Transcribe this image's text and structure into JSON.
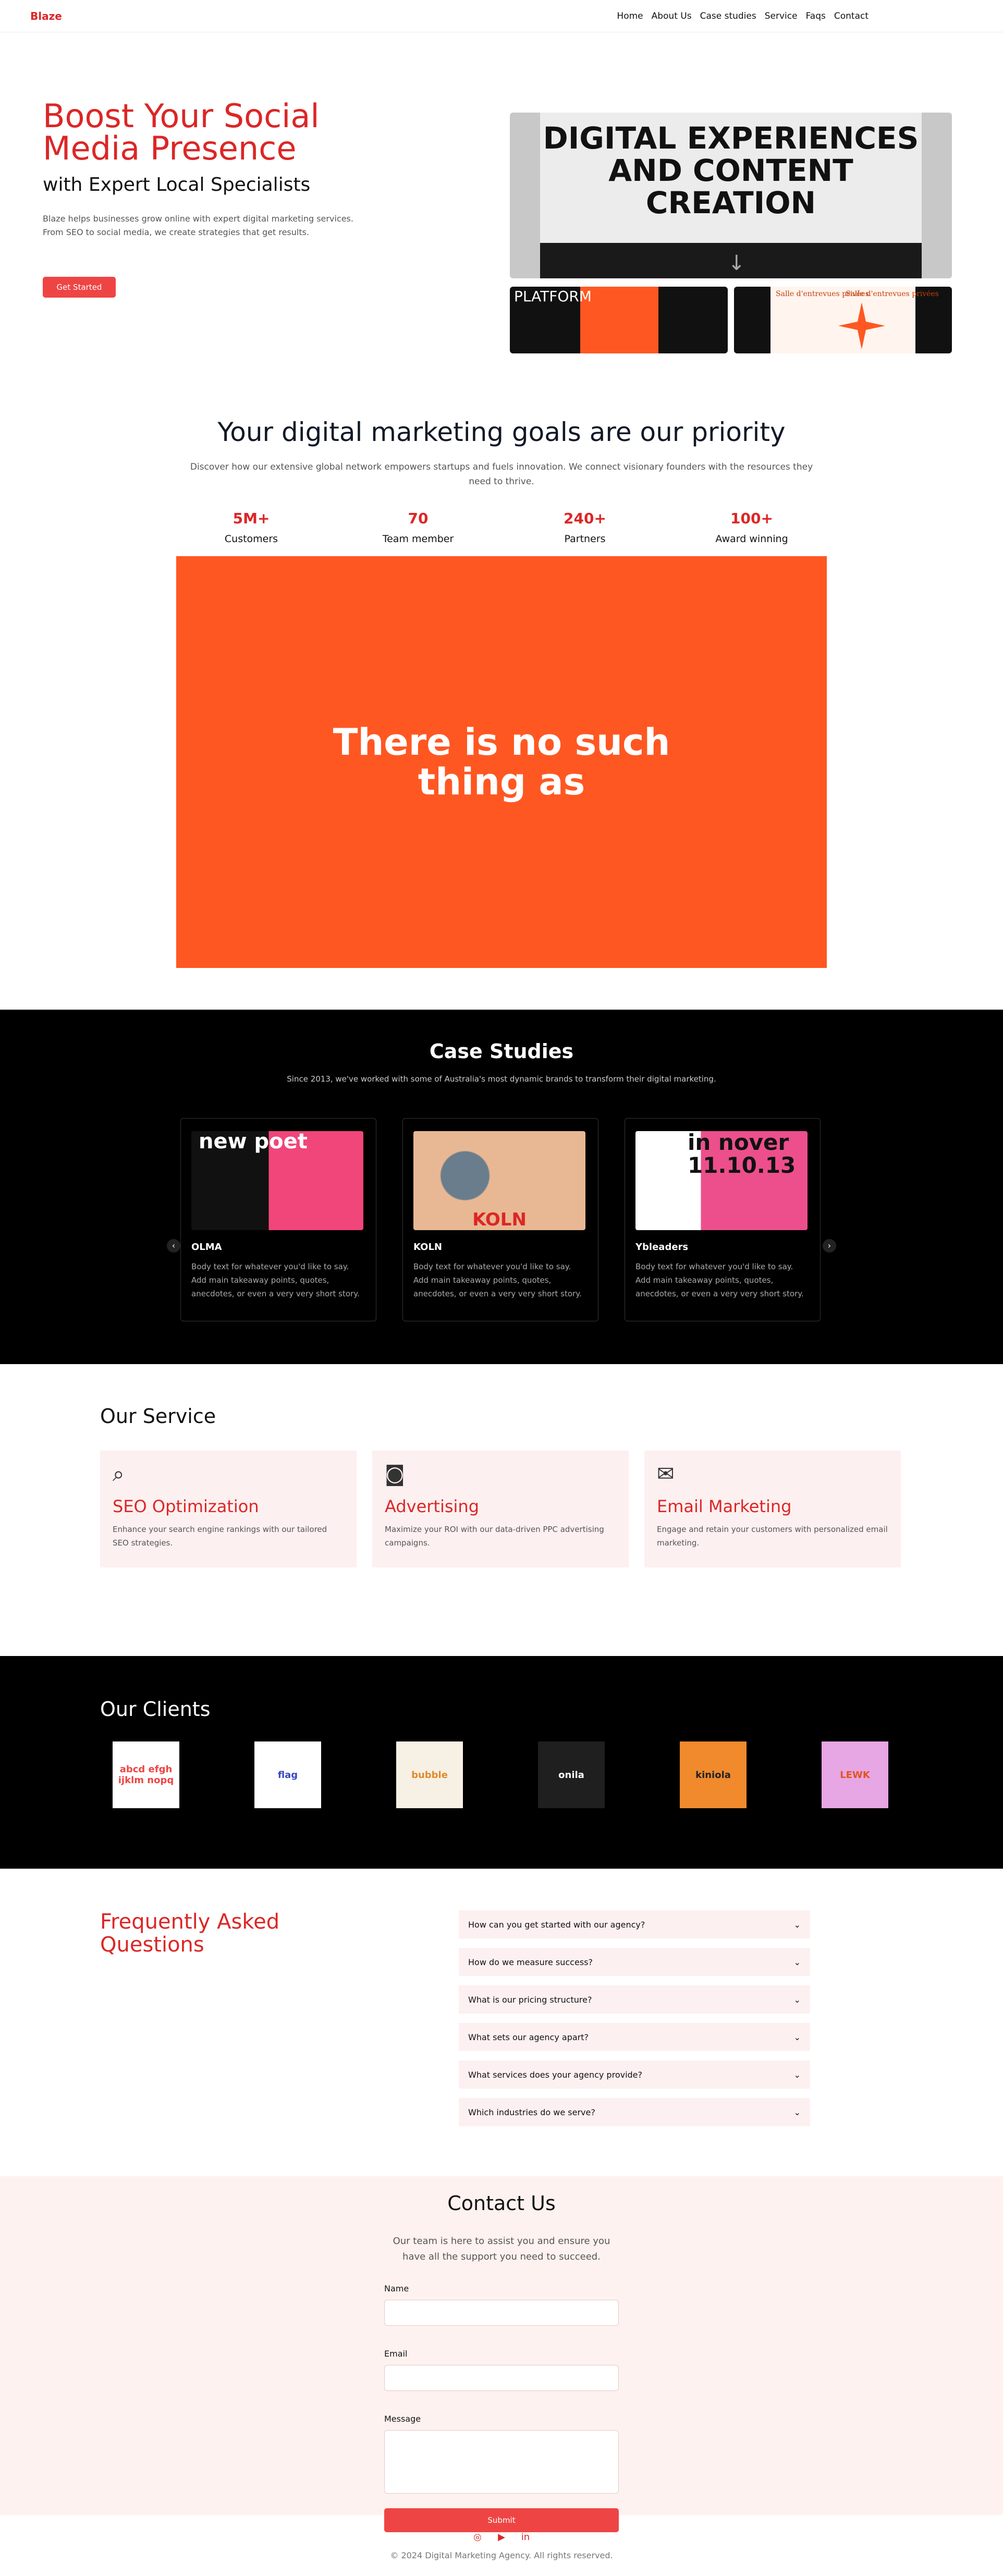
{
  "nav": {
    "brand": "Blaze",
    "links": [
      "Home",
      "About Us",
      "Case studies",
      "Service",
      "Faqs",
      "Contact"
    ]
  },
  "hero": {
    "title": "Boost Your Social Media Presence",
    "subtitle": "with Expert Local Specialists",
    "description": "Blaze helps businesses grow online with expert digital marketing services. From SEO to social media, we create strategies that get results.",
    "cta": "Get Started",
    "poster_text": "DIGITAL EXPERIENCES AND CONTENT CREATION",
    "thumb1_text": "PLATFORM",
    "thumb2_text": "Salle d'entrevues privées"
  },
  "goals": {
    "title": "Your digital marketing goals are our priority",
    "description": "Discover how our extensive global network empowers startups and fuels innovation. We connect visionary founders with the resources they need to thrive.",
    "stats": [
      {
        "value": "5M+",
        "label": "Customers"
      },
      {
        "value": "70",
        "label": "Team member"
      },
      {
        "value": "240+",
        "label": "Partners"
      },
      {
        "value": "100+",
        "label": "Award winning"
      }
    ],
    "quote": "There is no such thing as"
  },
  "cases": {
    "title": "Case Studies",
    "subtitle": "Since 2013, we've worked with some of Australia's most dynamic brands to transform their digital marketing.",
    "prev": "‹",
    "next": "›",
    "items": [
      {
        "name": "OLMA",
        "body": "Body text for whatever you'd like to say. Add main takeaway points, quotes, anecdotes, or even a very very short story.",
        "img_text": "new poet"
      },
      {
        "name": "KOLN",
        "body": "Body text for whatever you'd like to say. Add main takeaway points, quotes, anecdotes, or even a very very short story.",
        "img_text": "KOLN"
      },
      {
        "name": "Ybleaders",
        "body": "Body text for whatever you'd like to say. Add main takeaway points, quotes, anecdotes, or even a very very short story.",
        "img_text": "in nover 11.10.13"
      }
    ]
  },
  "service": {
    "title": "Our Service",
    "items": [
      {
        "icon": "search-icon",
        "glyph": "⌕",
        "title": "SEO Optimization",
        "body": "Enhance your search engine rankings with our tailored SEO strategies."
      },
      {
        "icon": "instagram-icon",
        "glyph": "◙",
        "title": "Advertising",
        "body": "Maximize your ROI with our data-driven PPC advertising campaigns."
      },
      {
        "icon": "mail-icon",
        "glyph": "✉",
        "title": "Email Marketing",
        "body": "Engage and retain your customers with personalized email marketing."
      }
    ]
  },
  "clients": {
    "title": "Our Clients",
    "logos": [
      {
        "text": "abcd efgh ijklm nopq",
        "bg": "#ffffff",
        "fg": "#ef4444"
      },
      {
        "text": "flag",
        "bg": "#ffffff",
        "fg": "#3b48c4"
      },
      {
        "text": "bubble",
        "bg": "#f7f0e4",
        "fg": "#e08a2c"
      },
      {
        "text": "onila",
        "bg": "#1f1f1f",
        "fg": "#ffffff"
      },
      {
        "text": "kiniola",
        "bg": "#f08a2c",
        "fg": "#222222"
      },
      {
        "text": "LEWK",
        "bg": "#e7a6e4",
        "fg": "#e0541c"
      }
    ]
  },
  "faq": {
    "title": "Frequently Asked Questions",
    "items": [
      "How can you get started with our agency?",
      "How do we measure success?",
      "What is our pricing structure?",
      "What sets our agency apart?",
      "What services does your agency provide?",
      "Which industries do we serve?"
    ],
    "chevron": "⌄"
  },
  "contact": {
    "title": "Contact Us",
    "description": "Our team is here to assist you and ensure you have all the support you need to succeed.",
    "name_label": "Name",
    "email_label": "Email",
    "message_label": "Message",
    "submit": "Submit"
  },
  "footer": {
    "socials": [
      {
        "icon": "instagram-icon",
        "glyph": "◎"
      },
      {
        "icon": "youtube-icon",
        "glyph": "▶"
      },
      {
        "icon": "linkedin-icon",
        "glyph": "in"
      }
    ],
    "copyright": "© 2024 Digital Marketing Agency. All rights reserved."
  },
  "colors": {
    "accent": "#dc2626",
    "orange": "#ff5722",
    "pink_bg": "#fdf0f0"
  }
}
